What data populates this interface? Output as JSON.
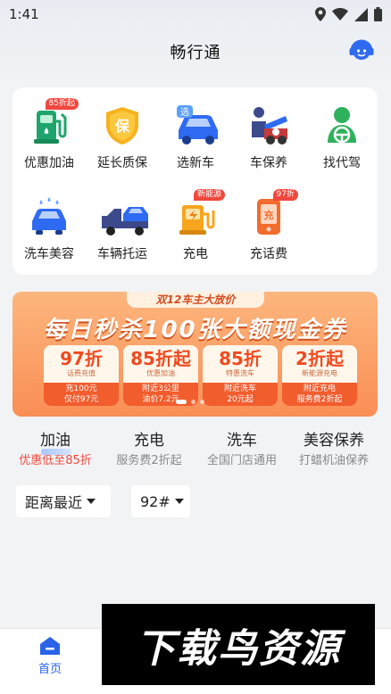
{
  "status_bar": {
    "time": "1:41"
  },
  "header": {
    "title": "畅行通"
  },
  "services": [
    {
      "label": "优惠加油",
      "badge": "85折起",
      "icon": "fuel-pump-icon"
    },
    {
      "label": "延长质保",
      "badge": "",
      "icon": "shield-warranty-icon",
      "icon_text": "保"
    },
    {
      "label": "选新车",
      "badge": "",
      "icon": "new-car-icon",
      "icon_text": "选"
    },
    {
      "label": "车保养",
      "badge": "",
      "icon": "car-maintenance-icon"
    },
    {
      "label": "找代驾",
      "badge": "",
      "icon": "driver-icon"
    },
    {
      "label": "洗车美容",
      "badge": "",
      "icon": "car-wash-icon"
    },
    {
      "label": "车辆托运",
      "badge": "",
      "icon": "tow-truck-icon"
    },
    {
      "label": "充电",
      "badge": "新能源",
      "icon": "charging-station-icon"
    },
    {
      "label": "充话费",
      "badge": "97折",
      "icon": "phone-recharge-icon",
      "icon_text": "充"
    }
  ],
  "banner": {
    "tag": "双12车主大放价",
    "headline": "每日秒杀100张大额现金券",
    "coupons": [
      {
        "amount": "97折",
        "title": "话费充值",
        "desc1": "充100元",
        "desc2": "仅付97元"
      },
      {
        "amount": "85折起",
        "title": "优惠加油",
        "desc1": "附近3公里",
        "desc2": "油价7.2元"
      },
      {
        "amount": "85折",
        "title": "特惠洗车",
        "desc1": "附近洗车",
        "desc2": "20元起"
      },
      {
        "amount": "2折起",
        "title": "新能源充电",
        "desc1": "附近充电",
        "desc2": "服务费2折起"
      }
    ]
  },
  "category_tabs": [
    {
      "name": "加油",
      "sub": "优惠低至85折",
      "active": true
    },
    {
      "name": "充电",
      "sub": "服务费2折起",
      "active": false
    },
    {
      "name": "洗车",
      "sub": "全国门店通用",
      "active": false
    },
    {
      "name": "美容保养",
      "sub": "打蜡机油保养",
      "active": false
    }
  ],
  "filters": {
    "sort": "距离最近",
    "fuel_type": "92#"
  },
  "tabbar": {
    "home_label": "首页"
  },
  "watermark": {
    "text": "下载鸟资源"
  },
  "colors": {
    "accent": "#2a62e8",
    "promo": "#f04a3e",
    "banner": "#fa8e55"
  }
}
